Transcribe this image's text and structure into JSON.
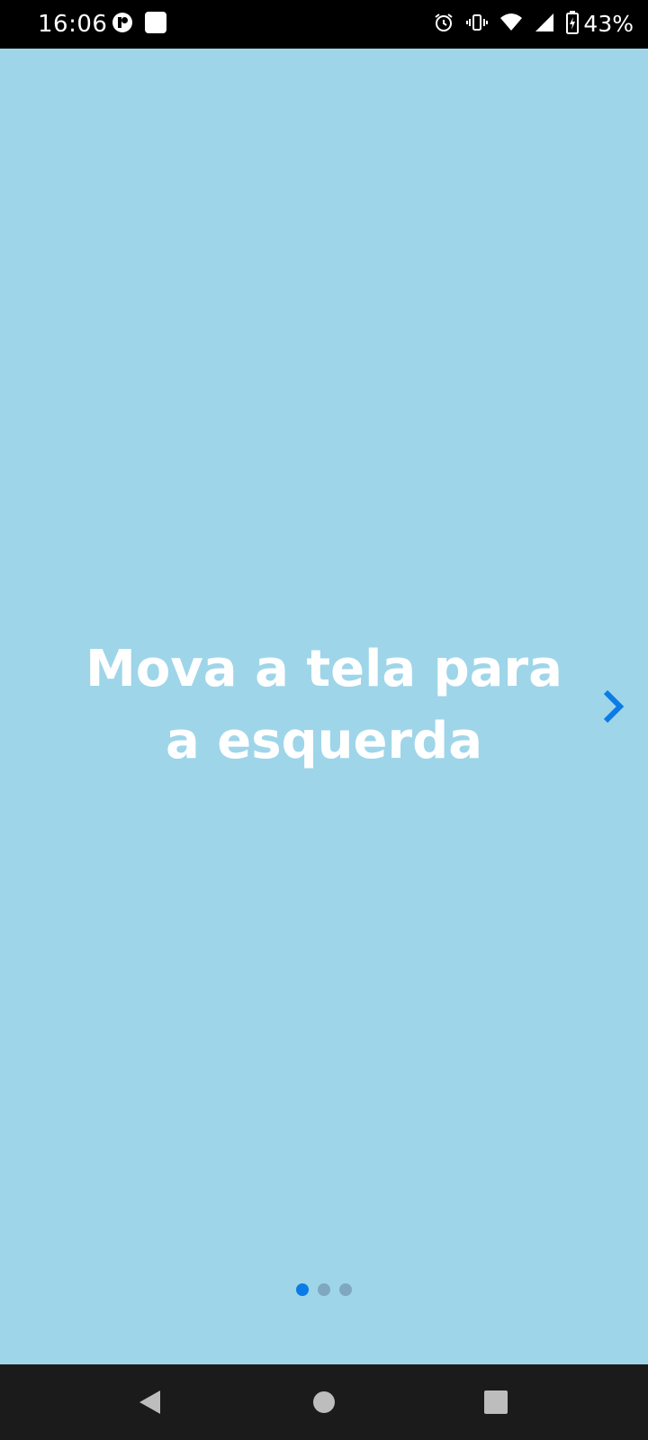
{
  "status_bar": {
    "time": "16:06",
    "battery_percent": "43%",
    "icons": [
      "app-notification-icon",
      "square-notification-icon",
      "alarm-icon",
      "vibrate-icon",
      "wifi-icon",
      "signal-icon",
      "battery-charging-icon"
    ]
  },
  "onboarding": {
    "headline_line1": "Mova a tela para",
    "headline_line2": "a esquerda",
    "next_icon": "chevron-right-icon",
    "page_count": 3,
    "current_page": 1
  },
  "navigation": {
    "buttons": [
      "back-icon",
      "home-icon",
      "recents-icon"
    ]
  },
  "colors": {
    "background": "#9ed5e9",
    "accent": "#0b7ce6",
    "inactive_dot": "#7fa7bd",
    "text": "#ffffff"
  }
}
